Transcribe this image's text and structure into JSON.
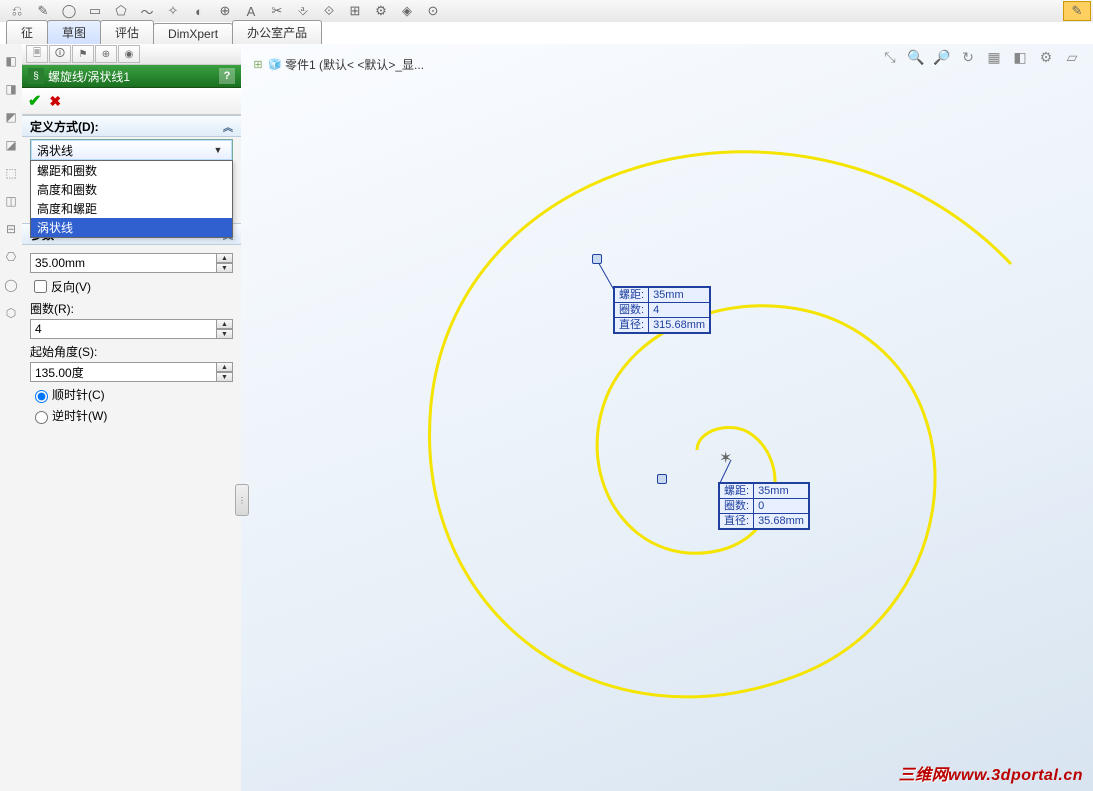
{
  "tabs": {
    "items": [
      "征",
      "草图",
      "评估",
      "DimXpert",
      "办公室产品"
    ],
    "active_index": 1
  },
  "panel_header": {
    "title": "螺旋线/涡状线1",
    "help": "?"
  },
  "section_define": {
    "header": "定义方式(D):",
    "dropdown_value": "涡状线",
    "options": [
      "螺距和圈数",
      "高度和圈数",
      "高度和螺距",
      "涡状线"
    ],
    "selected_index": 3
  },
  "section_params": {
    "header": "参数",
    "pitch_value": "35.00mm",
    "reverse_label": "反向(V)",
    "revolutions_label": "圈数(R):",
    "revolutions_value": "4",
    "start_angle_label": "起始角度(S):",
    "start_angle_value": "135.00度",
    "cw_label": "顺时针(C)",
    "ccw_label": "逆时针(W)"
  },
  "breadcrumb": {
    "expand": "⊞",
    "text": "零件1  (默认< <默认>_显..."
  },
  "callout_outer": {
    "rows": [
      {
        "k": "螺距:",
        "v": "35mm"
      },
      {
        "k": "圈数:",
        "v": "4"
      },
      {
        "k": "直径:",
        "v": "315.68mm"
      }
    ]
  },
  "callout_inner": {
    "rows": [
      {
        "k": "螺距:",
        "v": "35mm"
      },
      {
        "k": "圈数:",
        "v": "0"
      },
      {
        "k": "直径:",
        "v": "35.68mm"
      }
    ]
  },
  "watermark": {
    "cn": "三维网",
    "url": "www.3dportal.cn"
  }
}
